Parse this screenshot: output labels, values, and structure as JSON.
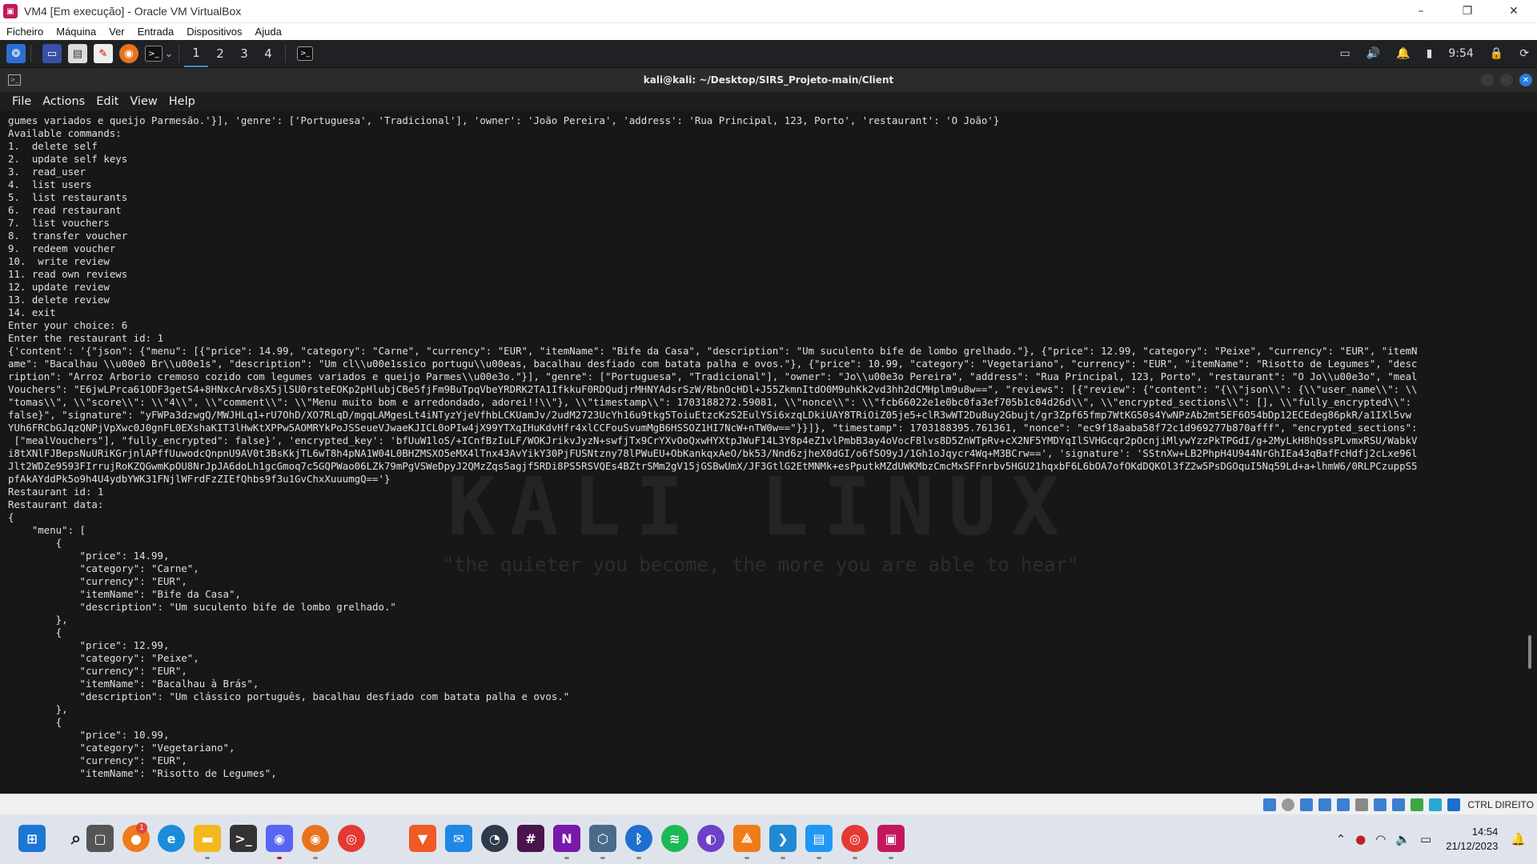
{
  "window": {
    "title": "VM4 [Em execução] - Oracle VM VirtualBox",
    "controls": [
      "–",
      "❐",
      "✕"
    ]
  },
  "vbox_menu": [
    "Ficheiro",
    "Máquina",
    "Ver",
    "Entrada",
    "Dispositivos",
    "Ajuda"
  ],
  "kali_panel": {
    "workspaces": [
      "1",
      "2",
      "3",
      "4"
    ],
    "active_workspace": "1",
    "time": "9:54"
  },
  "terminal": {
    "title": "kali@kali: ~/Desktop/SIRS_Projeto-main/Client",
    "menu": [
      "File",
      "Actions",
      "Edit",
      "View",
      "Help"
    ],
    "watermark": "KALI LINUX",
    "tagline": "\"the quieter you become, the more you are able to hear\"",
    "output": "gumes variados e queijo Parmesão.'}], 'genre': ['Portuguesa', 'Tradicional'], 'owner': 'João Pereira', 'address': 'Rua Principal, 123, Porto', 'restaurant': 'O João'}\nAvailable commands:\n1.  delete self\n2.  update self keys\n3.  read_user\n4.  list users\n5.  list restaurants\n6.  read restaurant\n7.  list vouchers\n8.  transfer voucher\n9.  redeem voucher\n10.  write review\n11. read own reviews\n12. update review\n13. delete review\n14. exit\nEnter your choice: 6\nEnter the restaurant id: 1\n{'content': '{\"json\": {\"menu\": [{\"price\": 14.99, \"category\": \"Carne\", \"currency\": \"EUR\", \"itemName\": \"Bife da Casa\", \"description\": \"Um suculento bife de lombo grelhado.\"}, {\"price\": 12.99, \"category\": \"Peixe\", \"currency\": \"EUR\", \"itemN\name\": \"Bacalhau \\\\u00e0 Br\\\\u00e1s\", \"description\": \"Um cl\\\\u00e1ssico portugu\\\\u00eas, bacalhau desfiado com batata palha e ovos.\"}, {\"price\": 10.99, \"category\": \"Vegetariano\", \"currency\": \"EUR\", \"itemName\": \"Risotto de Legumes\", \"desc\nription\": \"Arroz Arborio cremoso cozido com legumes variados e queijo Parmes\\\\u00e3o.\"}], \"genre\": [\"Portuguesa\", \"Tradicional\"], \"owner\": \"Jo\\\\u00e3o Pereira\", \"address\": \"Rua Principal, 123, Porto\", \"restaurant\": \"O Jo\\\\u00e3o\", \"meal\nVouchers\": \"E6jwLPrca61ODF3getS4+8HNxcArv8sX5jlSU0rsteEOKp2pHlubjCBe5fjFm9BuTpqVbeYRDRK2TA1IfkkuF0RDQudjrMHNYAdsrSzW/RbnOcHDl+J55ZkmnItdO0M9uhKk2vd3hh2dCMHplm9u8w==\", \"reviews\": [{\"review\": {\"content\": \"{\\\\\"json\\\\\": {\\\\\"user_name\\\\\": \\\\\n\"tomas\\\\\", \\\\\"score\\\\\": \\\\\"4\\\\\", \\\\\"comment\\\\\": \\\\\"Menu muito bom e arredondado, adorei!!\\\\\"}, \\\\\"timestamp\\\\\": 1703188272.59081, \\\\\"nonce\\\\\": \\\\\"fcb66022e1e0bc0fa3ef705b1c04d26d\\\\\", \\\\\"encrypted_sections\\\\\": [], \\\\\"fully_encrypted\\\\\": \nfalse}\", \"signature\": \"yFWPa3dzwgQ/MWJHLq1+rU7OhD/XO7RLqD/mgqLAMgesLt4iNTyzYjeVfhbLCKUamJv/2udM2723UcYh16u9tkg5ToiuEtzcKzS2EulYSi6xzqLDkiUAY8TRiOiZ05je5+clR3wWT2Du8uy2Gbujt/gr3Zpf65fmp7WtKG50s4YwNPzAb2mt5EF6O54bDp12ECEdeg86pkR/a1IXl5vw\nYUh6FRCbGJqzQNPjVpXwc0J0gnFL0EXshaKIT3lHwKtXPPw5AOMRYkPoJSSeueVJwaeKJICL0oPIw4jX99YTXqIHuKdvHfr4xlCCFouSvumMgB6HSSOZ1HI7NcW+nTW0w==\"}}]}, \"timestamp\": 1703188395.761361, \"nonce\": \"ec9f18aaba58f72c1d969277b870afff\", \"encrypted_sections\":\n [\"mealVouchers\"], \"fully_encrypted\": false}', 'encrypted_key': 'bfUuW1loS/+ICnfBzIuLF/WOKJrikvJyzN+swfjTx9CrYXvOoQxwHYXtpJWuF14L3Y8p4eZ1vlPmbB3ay4oVocF8lvs8D5ZnWTpRv+cX2NF5YMDYqIlSVHGcqr2pOcnjiMlywYzzPkTPGdI/g+2MyLkH8hQssPLvmxRSU/WabkV\ni8tXNlFJBepsNuURiKGrjnlAPffUuwodcQnpnU9AV0t3BsKkjTL6wT8h4pNA1W04L0BHZMSXO5eMX4lTnx43AvYikY30PjFUSNtzny78lPWuEU+ObKankqxAeO/bk53/Nnd6zjheX0dGI/o6fSO9yJ/1Gh1oJqycr4Wq+M3BCrw==', 'signature': 'SStnXw+LB2PhpH4U944NrGhIEa43qBafFcHdfj2cLxe96l\nJlt2WDZe9593FIrrujRoKZQGwmKpOU8NrJpJA6doLh1gcGmoq7c5GQPWao06LZk79mPgVSWeDpyJ2QMzZqs5agjf5RDi8PS5RSVQEs4BZtrSMm2gV15jGSBwUmX/JF3GtlG2EtMNMk+esPputkMZdUWKMbzCmcMxSFFnrbv5HGU21hqxbF6L6bOA7ofOKdDQKOl3fZ2w5PsDGOquI5Nq59Ld+a+lhmW6/0RLPCzuppS5\npfAkAYddPk5o9h4U4ydbYWK31FNjlWFrdFzZIEfQhbs9f3u1GvChxXuuumgQ=='}\nRestaurant id: 1\nRestaurant data:\n{\n    \"menu\": [\n        {\n            \"price\": 14.99,\n            \"category\": \"Carne\",\n            \"currency\": \"EUR\",\n            \"itemName\": \"Bife da Casa\",\n            \"description\": \"Um suculento bife de lombo grelhado.\"\n        },\n        {\n            \"price\": 12.99,\n            \"category\": \"Peixe\",\n            \"currency\": \"EUR\",\n            \"itemName\": \"Bacalhau à Brás\",\n            \"description\": \"Um clássico português, bacalhau desfiado com batata palha e ovos.\"\n        },\n        {\n            \"price\": 10.99,\n            \"category\": \"Vegetariano\",\n            \"currency\": \"EUR\",\n            \"itemName\": \"Risotto de Legumes\","
  },
  "status_bar": {
    "host_key": "CTRL DIREITO"
  },
  "taskbar": {
    "notification_badge": "1",
    "time": "14:54",
    "date": "21/12/2023"
  },
  "colors": {
    "terminal_bg": "#171717",
    "terminal_fg": "#e0e0e0",
    "accent": "#3d8fd6",
    "taskbar_bg": "#dfe4ec"
  }
}
